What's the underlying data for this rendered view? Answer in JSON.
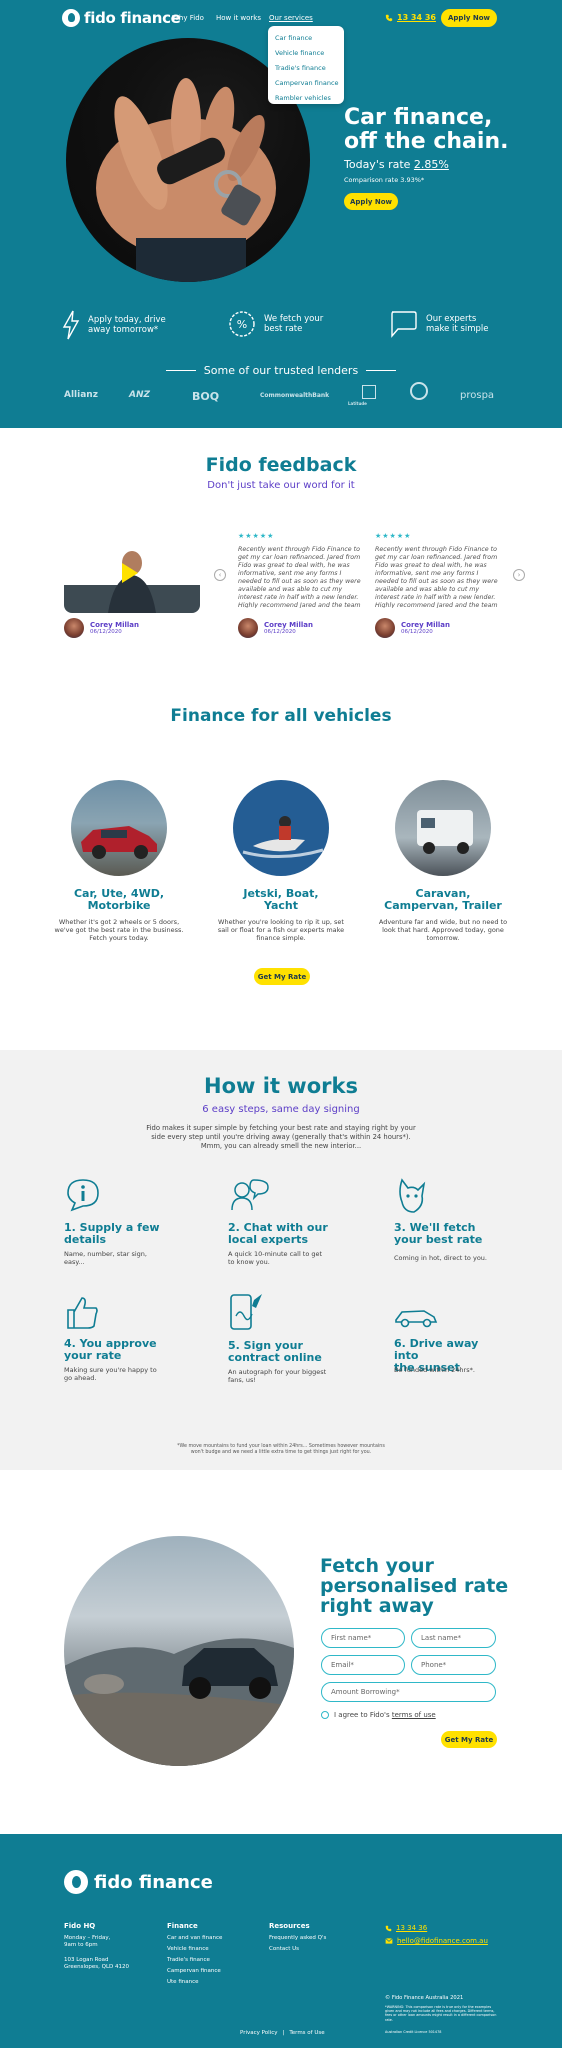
{
  "header": {
    "brand": "fido finance",
    "nav": [
      "Why Fido",
      "How it works",
      "Our services"
    ],
    "phone": "13 34 36",
    "apply_label": "Apply Now",
    "dropdown": [
      "Car finance",
      "Vehicle finance",
      "Tradie's finance",
      "Campervan finance",
      "Rambler vehicles"
    ]
  },
  "hero": {
    "title_line1": "Car finance,",
    "title_line2": "off the chain.",
    "rate_label": "Today's rate",
    "rate_value": "2.85%",
    "comparison": "Comparison rate 3.93%*",
    "apply_label": "Apply Now"
  },
  "features": [
    {
      "icon": "lightning-icon",
      "line1": "Apply today, drive",
      "line2": "away tomorrow*"
    },
    {
      "icon": "percent-badge-icon",
      "line1": "We fetch your",
      "line2": "best rate"
    },
    {
      "icon": "chat-bubble-icon",
      "line1": "Our experts",
      "line2": "make it simple"
    }
  ],
  "lenders": {
    "title": "Some of our trusted lenders",
    "names": [
      "Allianz",
      "ANZ",
      "BOQ",
      "CommonwealthBank",
      "Latitude",
      "",
      "prospa"
    ]
  },
  "feedback": {
    "title": "Fido feedback",
    "subtitle": "Don't just take our word for it",
    "stars": "★★★★★",
    "review_text": "Recently went through Fido Finance to get my car loan refinanced. Jared from Fido was great to deal with, he was informative, sent me any forms I needed to fill out as soon as they were available and was able to cut my interest rate in half with a new lender. Highly recommend Jared and the team at Fido",
    "reviews": [
      {
        "name": "Corey Millan",
        "date": "06/12/2020"
      },
      {
        "name": "Corey Millan",
        "date": "06/12/2020"
      },
      {
        "name": "Corey Millan",
        "date": "06/12/2020"
      }
    ]
  },
  "vehicles": {
    "title": "Finance for all vehicles",
    "items": [
      {
        "title_line1": "Car, Ute, 4WD,",
        "title_line2": "Motorbike",
        "desc": "Whether it's got 2 wheels or 5 doors, we've got the best rate in the business. Fetch yours today."
      },
      {
        "title_line1": "Jetski, Boat,",
        "title_line2": "Yacht",
        "desc": "Whether you're looking to rip it up, set sail or float for a fish our experts make finance simple."
      },
      {
        "title_line1": "Caravan,",
        "title_line2": "Campervan, Trailer",
        "desc": "Adventure far and wide, but no need to look that hard. Approved today, gone tomorrow."
      }
    ],
    "cta": "Get My Rate"
  },
  "how": {
    "title": "How it works",
    "subtitle": "6 easy steps, same day signing",
    "intro": "Fido makes it super simple by fetching your best rate and staying right by your side every step until you're driving away (generally that's within 24 hours*). Mmm, you can already smell the new interior...",
    "steps": [
      {
        "icon": "info-icon",
        "title_line1": "1. Supply a few",
        "title_line2": "details",
        "desc": "Name, number, star sign, easy..."
      },
      {
        "icon": "headset-agent-icon",
        "title_line1": "2. Chat with our",
        "title_line2": "local experts",
        "desc": "A quick 10-minute call to get to know you."
      },
      {
        "icon": "dog-icon",
        "title_line1": "3. We'll fetch",
        "title_line2": "your best rate",
        "desc": "Coming in hot, direct to you."
      },
      {
        "icon": "thumbs-up-icon",
        "title_line1": "4. You approve",
        "title_line2": "your rate",
        "desc": "Making sure you're happy to go ahead."
      },
      {
        "icon": "phone-sign-icon",
        "title_line1": "5. Sign your",
        "title_line2": "contract online",
        "desc": "An autograph for your biggest fans, us!"
      },
      {
        "icon": "car-icon",
        "title_line1": "6. Drive away into",
        "title_line2": "the sunset",
        "desc": "Be funded within 24hrs*."
      }
    ],
    "footnote": "*We move mountains to fund your loan within 24hrs... Sometimes however mountains won't budge and we need a little extra time to get things just right for you."
  },
  "form": {
    "title_line1": "Fetch your",
    "title_line2": "personalised rate",
    "title_line3": "right away",
    "first_name": "First name*",
    "last_name": "Last name*",
    "email": "Email*",
    "phone": "Phone*",
    "amount": "Amount Borrowing*",
    "agree_prefix": "I agree to Fido's",
    "agree_link": "terms of use",
    "submit": "Get My Rate"
  },
  "footer": {
    "brand": "fido finance",
    "hq_title": "Fido HQ",
    "hours": "Monday – Friday,\n9am to 6pm",
    "address": "103 Logan Road\nGreenslopes, QLD 4120",
    "finance_title": "Finance",
    "finance_links": [
      "Car and van finance",
      "Vehicle finance",
      "Tradie's finance",
      "Campervan finance",
      "Ute finance"
    ],
    "resources_title": "Resources",
    "resources_links": [
      "Frequently asked Q's",
      "Contact Us"
    ],
    "phone": "13 34 36",
    "email": "hello@fidofinance.com.au",
    "copyright": "© Fido Finance Australia 2021",
    "warning": "*WARNING: This comparison rate is true only for the examples given and may not include all fees and charges. Different terms, fees or other loan amounts might result in a different comparison rate.",
    "licence": "Australian Credit Licence 501478",
    "privacy": "Privacy Policy",
    "terms": "Terms of Use"
  },
  "colors": {
    "teal": "#0f7d93",
    "yellow": "#ffe100",
    "purple": "#5c3ec7",
    "aqua": "#2fb8c8"
  }
}
